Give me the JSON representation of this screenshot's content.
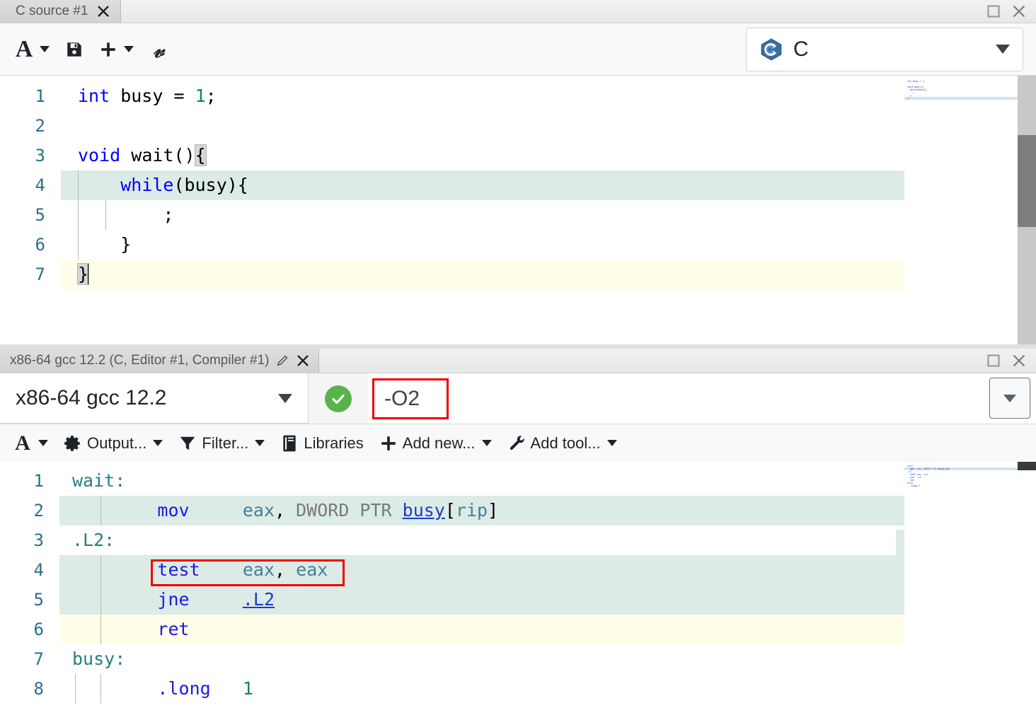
{
  "window": {
    "maximize_icon": "maximize-icon",
    "close_icon": "close-icon"
  },
  "editor_pane": {
    "tab": {
      "label": "C source #1",
      "close_icon": "close-icon"
    },
    "toolbar": {
      "font_button_label": "A",
      "font_button_icon": "font-size-icon",
      "save_icon": "save-icon",
      "add_icon": "plus-icon",
      "vim_icon": "vim-icon"
    },
    "language_selector": {
      "value": "C",
      "icon": "c-language-icon",
      "caret_icon": "chevron-down-icon"
    },
    "code_lines": [
      {
        "n": "1",
        "highlight": "none"
      },
      {
        "n": "2",
        "highlight": "none"
      },
      {
        "n": "3",
        "highlight": "none"
      },
      {
        "n": "4",
        "highlight": "teal"
      },
      {
        "n": "5",
        "highlight": "none"
      },
      {
        "n": "6",
        "highlight": "none"
      },
      {
        "n": "7",
        "highlight": "yellow"
      }
    ],
    "code_text": [
      "int busy = 1;",
      "",
      "void wait(){",
      "    while(busy){",
      "        ;",
      "    }",
      "}"
    ]
  },
  "compiler_pane": {
    "tab": {
      "label": "x86-64 gcc 12.2 (C, Editor #1, Compiler #1)",
      "edit_icon": "pencil-icon",
      "close_icon": "close-icon"
    },
    "compiler_select": {
      "value": "x86-64 gcc 12.2",
      "caret_icon": "chevron-down-icon"
    },
    "status": {
      "icon": "check-circle-icon",
      "color": "#58b348"
    },
    "options": {
      "value": "-O2",
      "highlight_color": "#ee0000",
      "dropdown_icon": "chevron-down-icon"
    },
    "toolbar": [
      {
        "label": "A",
        "icon": "font-size-icon",
        "caret": true
      },
      {
        "label": "Output...",
        "icon": "gear-icon",
        "caret": true
      },
      {
        "label": "Filter...",
        "icon": "funnel-icon",
        "caret": true
      },
      {
        "label": "Libraries",
        "icon": "book-icon",
        "caret": false
      },
      {
        "label": "Add new...",
        "icon": "plus-icon",
        "caret": true
      },
      {
        "label": "Add tool...",
        "icon": "wrench-icon",
        "caret": true
      }
    ],
    "asm_lines": [
      {
        "n": "1",
        "highlight": "none"
      },
      {
        "n": "2",
        "highlight": "teal"
      },
      {
        "n": "3",
        "highlight": "none"
      },
      {
        "n": "4",
        "highlight": "teal"
      },
      {
        "n": "5",
        "highlight": "teal"
      },
      {
        "n": "6",
        "highlight": "yellow"
      },
      {
        "n": "7",
        "highlight": "none"
      },
      {
        "n": "8",
        "highlight": "none"
      }
    ],
    "asm_text": [
      "wait:",
      "        mov     eax, DWORD PTR busy[rip]",
      ".L2:",
      "        test    eax, eax",
      "        jne     .L2",
      "        ret",
      "busy:",
      "        .long   1"
    ],
    "annotation": {
      "target_text": "test    eax, eax",
      "box_color": "#ee0000"
    }
  }
}
